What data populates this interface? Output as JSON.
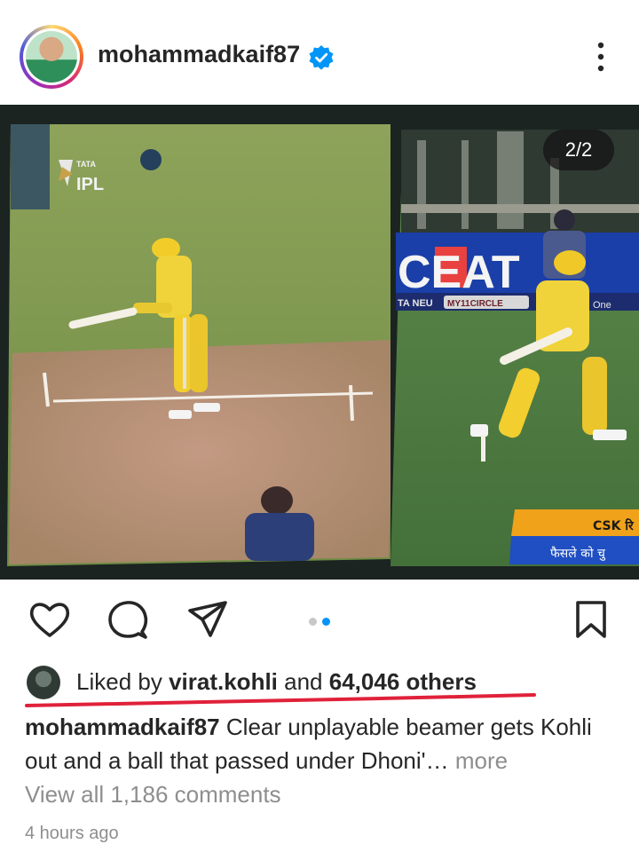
{
  "post": {
    "username": "mohammadkaif87",
    "verified": true,
    "image_counter": "2/2",
    "left_panel": {
      "logo_top": "TATA",
      "logo_bottom": "IPL"
    },
    "right_panel": {
      "board_text": "CEAT",
      "ad_left": "TA NEU",
      "ad_mid": "MY11CIRCLE",
      "ad_right": "One",
      "ticker_top": "CSK रि",
      "ticker_bottom": "फैसले को चु"
    },
    "carousel": {
      "count": 2,
      "active_index": 1
    },
    "likes": {
      "prefix": "Liked by",
      "user": "virat.kohli",
      "connector": "and",
      "others": "64,046 others"
    },
    "caption": {
      "user": "mohammadkaif87",
      "text": "Clear unplayable beamer gets Kohli out and a ball that passed under Dhoni'…",
      "more": "more"
    },
    "comments_link": "View all 1,186 comments",
    "timestamp": "4 hours ago"
  },
  "colors": {
    "verified_blue": "#0095f6",
    "active_dot": "#0095f6",
    "inactive_dot": "#c8c8c8",
    "highlight_red": "#e0213a",
    "pitch_green": "#7c9a4a",
    "ticker_orange": "#f0a21a",
    "ticker_blue": "#1f4fc2"
  },
  "icons": [
    "more-vertical-icon",
    "verified-badge-icon",
    "heart-icon",
    "comment-icon",
    "share-icon",
    "bookmark-icon"
  ]
}
